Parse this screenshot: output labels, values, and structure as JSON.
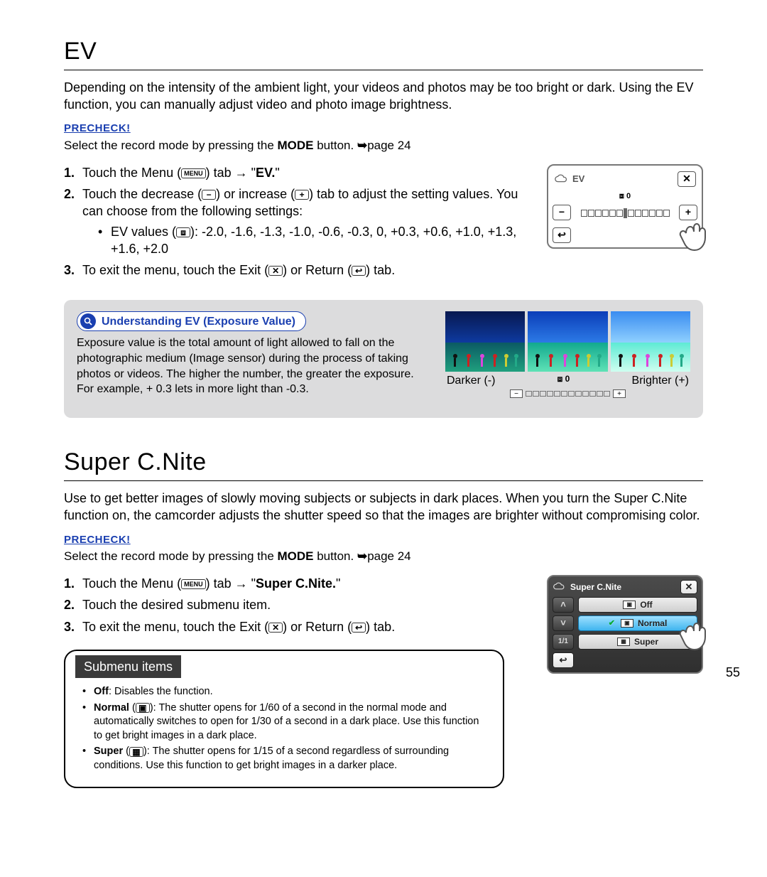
{
  "page_number": "55",
  "ev": {
    "title": "EV",
    "intro": "Depending on the intensity of the ambient light, your videos and photos may be too bright or dark. Using the EV function, you can manually adjust video and photo image brightness.",
    "precheck_label": "PRECHECK!",
    "precheck_text_a": "Select the record mode by pressing the ",
    "precheck_mode": "MODE",
    "precheck_text_b": " button. ",
    "precheck_page": "page 24",
    "step1_a": "Touch the Menu (",
    "menu_icon": "MENU",
    "step1_b": ") tab → \"",
    "step1_bold": "EV.",
    "step1_c": "\"",
    "step2_a": "Touch the decrease (",
    "minus_icon": "−",
    "step2_b": ") or increase (",
    "plus_icon": "+",
    "step2_c": ") tab to adjust the setting values. You can choose from the following settings:",
    "bullet_a": "EV values (",
    "ev_icon": "⧈",
    "bullet_b": "): -2.0, -1.6, -1.3, -1.0, -0.6, -0.3, 0, +0.3, +0.6, +1.0, +1.3, +1.6, +2.0",
    "step3_a": "To exit the menu, touch the Exit (",
    "exit_icon": "✕",
    "step3_b": ") or Return (",
    "return_icon": "↩",
    "step3_c": ") tab.",
    "panel": {
      "title": "EV",
      "indicator": "⧈ 0",
      "minus": "−",
      "plus": "+",
      "close": "✕",
      "return": "↩"
    },
    "info": {
      "chip": "Understanding EV (Exposure Value)",
      "text": "Exposure value is the total amount of light allowed to fall on the photographic medium (Image sensor) during the process of taking photos or videos. The higher the number, the greater the exposure. For example, + 0.3 lets in more light than -0.3.",
      "caption_left": "Darker (-)",
      "caption_mid": "⧈ 0",
      "caption_right": "Brighter (+)",
      "scale_minus": "−",
      "scale_plus": "+"
    }
  },
  "scn": {
    "title": "Super C.Nite",
    "intro": "Use to get better images of slowly moving subjects or subjects in dark places. When you turn the Super C.Nite function on, the camcorder adjusts the shutter speed so that the images are brighter without compromising color.",
    "precheck_label": "PRECHECK!",
    "precheck_text_a": "Select the record mode by pressing the ",
    "precheck_mode": "MODE",
    "precheck_text_b": " button. ",
    "precheck_page": "page 24",
    "step1_a": "Touch the Menu (",
    "menu_icon": "MENU",
    "step1_b": ") tab → \"",
    "step1_bold": "Super C.Nite.",
    "step1_c": "\"",
    "step2": "Touch the desired submenu item.",
    "step3_a": "To exit the menu, touch the Exit (",
    "exit_icon": "✕",
    "step3_b": ") or Return (",
    "return_icon": "↩",
    "step3_c": ") tab.",
    "panel": {
      "title": "Super C.Nite",
      "item_off": "Off",
      "item_normal": "Normal",
      "item_super": "Super",
      "up": "˄",
      "down": "˅",
      "page": "1/1",
      "close": "✕",
      "return": "↩"
    },
    "submenu": {
      "heading": "Submenu items",
      "off_label": "Off",
      "off_text": ": Disables the function.",
      "normal_label": "Normal",
      "normal_text": " The shutter opens for 1/60 of a second in the normal mode and automatically switches to open for 1/30 of a second in a dark place. Use this function to get bright images in a dark place.",
      "super_label": "Super",
      "super_text": " The shutter opens for 1/15 of a second regardless of surrounding conditions. Use this function to get bright images in a darker place."
    }
  }
}
